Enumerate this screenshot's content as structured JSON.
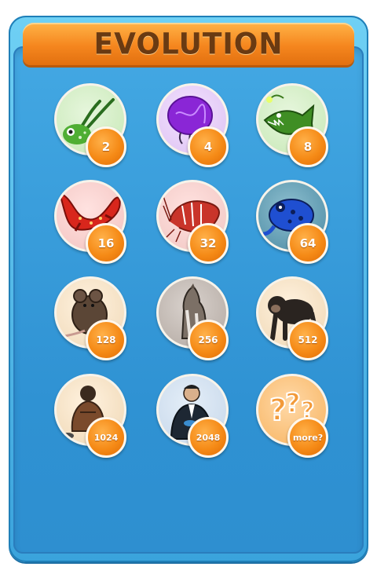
{
  "title": "EVOLUTION",
  "colors": {
    "frame": "#3aa3dc",
    "title_bar": "#f5861e",
    "title_text": "#6a3a12",
    "badge": "#f58a16"
  },
  "stages": [
    {
      "name": "tadpole-icon",
      "badge": "2"
    },
    {
      "name": "jellyfish-icon",
      "badge": "4"
    },
    {
      "name": "anglerfish-icon",
      "badge": "8"
    },
    {
      "name": "salamander-icon",
      "badge": "16"
    },
    {
      "name": "shrimp-icon",
      "badge": "32"
    },
    {
      "name": "poison-frog-icon",
      "badge": "64"
    },
    {
      "name": "rat-icon",
      "badge": "128"
    },
    {
      "name": "wolf-icon",
      "badge": "256"
    },
    {
      "name": "chimpanzee-icon",
      "badge": "512"
    },
    {
      "name": "caveman-icon",
      "badge": "1024"
    },
    {
      "name": "businessman-icon",
      "badge": "2048"
    },
    {
      "name": "question-marks-icon",
      "badge": "more?"
    }
  ]
}
